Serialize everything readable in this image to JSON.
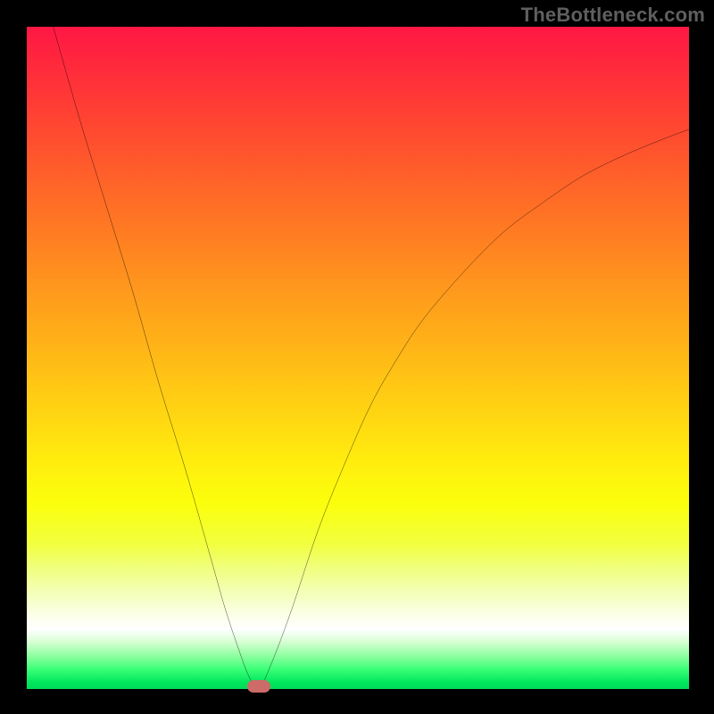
{
  "watermark": "TheBottleneck.com",
  "colors": {
    "background": "#000000",
    "curve": "#000000",
    "marker": "#cc6b68"
  },
  "chart_data": {
    "type": "line",
    "title": "",
    "xlabel": "",
    "ylabel": "",
    "xlim": [
      0,
      100
    ],
    "ylim": [
      0,
      100
    ],
    "grid": false,
    "series": [
      {
        "name": "bottleneck-curve",
        "x": [
          4,
          8,
          12,
          16,
          20,
          24,
          28,
          30,
          32,
          33.5,
          35,
          37,
          40,
          44,
          48,
          52,
          56,
          60,
          66,
          72,
          78,
          84,
          90,
          96,
          100
        ],
        "y": [
          100,
          86,
          73,
          60,
          46,
          33,
          19,
          12,
          6,
          2,
          0,
          4,
          12,
          24,
          34,
          43,
          50,
          56,
          63,
          69,
          73.5,
          77.5,
          80.5,
          83,
          84.5
        ]
      }
    ],
    "annotations": [
      {
        "name": "optimal-point",
        "x": 35,
        "y": 0
      }
    ]
  }
}
